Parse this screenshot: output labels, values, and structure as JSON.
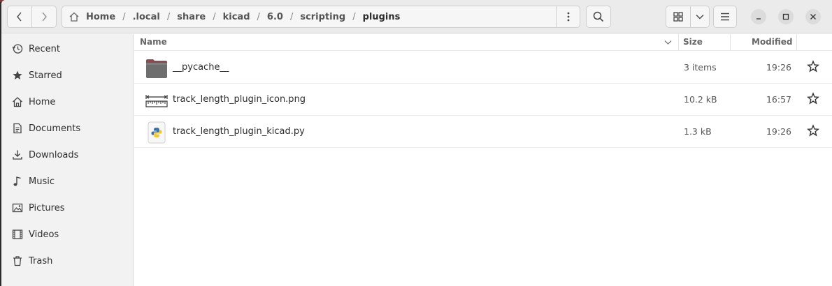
{
  "path": {
    "segments": [
      ".local",
      "share",
      "kicad",
      "6.0",
      "scripting",
      "plugins"
    ],
    "home_label": "Home"
  },
  "sidebar": {
    "items": [
      {
        "label": "Recent",
        "icon": "clock-icon"
      },
      {
        "label": "Starred",
        "icon": "star-icon"
      },
      {
        "label": "Home",
        "icon": "home-icon"
      },
      {
        "label": "Documents",
        "icon": "document-icon"
      },
      {
        "label": "Downloads",
        "icon": "download-icon"
      },
      {
        "label": "Music",
        "icon": "music-icon"
      },
      {
        "label": "Pictures",
        "icon": "picture-icon"
      },
      {
        "label": "Videos",
        "icon": "video-icon"
      },
      {
        "label": "Trash",
        "icon": "trash-icon"
      }
    ]
  },
  "columns": {
    "name": "Name",
    "size": "Size",
    "modified": "Modified"
  },
  "files": [
    {
      "name": "__pycache__",
      "size": "3 items",
      "modified": "19:26",
      "icon": "folder-icon"
    },
    {
      "name": "track_length_plugin_icon.png",
      "size": "10.2 kB",
      "modified": "16:57",
      "icon": "image-file-icon"
    },
    {
      "name": "track_length_plugin_kicad.py",
      "size": "1.3 kB",
      "modified": "19:26",
      "icon": "python-file-icon"
    }
  ],
  "colors": {
    "folder": "#7a5a5a",
    "accent": "#e95420"
  }
}
